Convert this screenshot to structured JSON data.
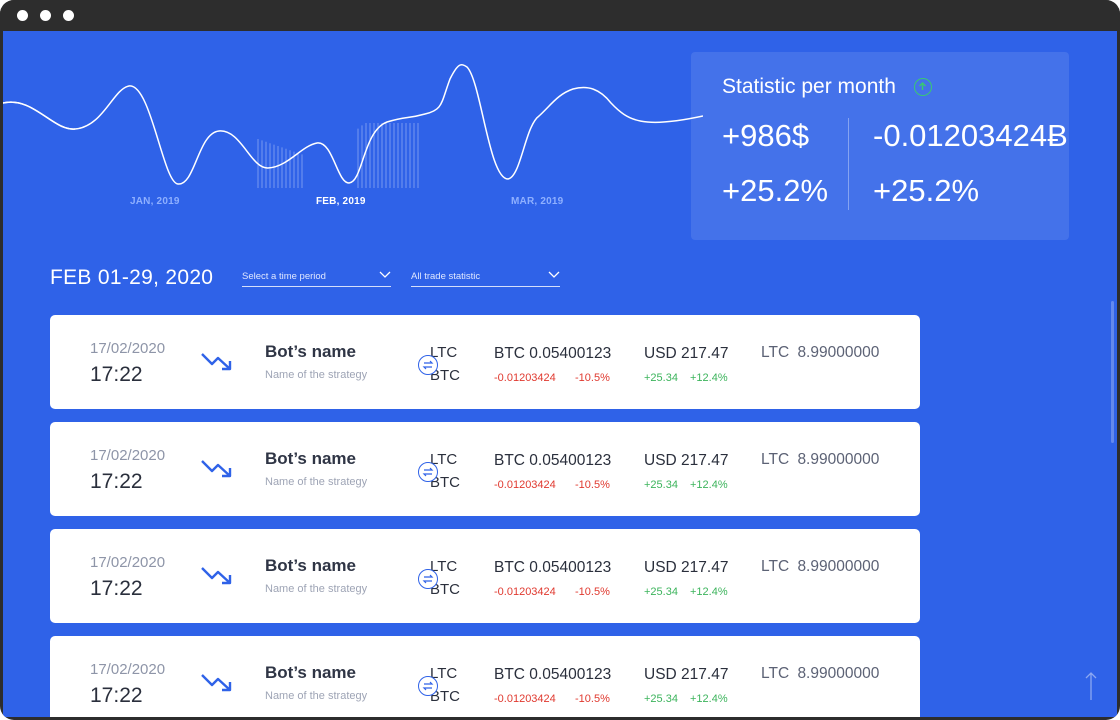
{
  "chart": {
    "months": [
      "JAN, 2019",
      "FEB, 2019",
      "MAR, 2019"
    ],
    "active_month": "FEB, 2019"
  },
  "stats": {
    "title": "Statistic per month",
    "usd_value": "+986$",
    "btc_value": "-0.01203424Ƀ",
    "usd_percent": "+25.2%",
    "btc_percent": "+25.2%"
  },
  "filters": {
    "period": "FEB 01-29, 2020",
    "time_period_placeholder": "Select a time period",
    "trade_statistic": "All trade statistic"
  },
  "trades": [
    {
      "date": "17/02/2020",
      "time": "17:22",
      "bot": "Bot’s name",
      "strategy": "Name of the strategy",
      "pair_from": "LTC",
      "pair_to": "BTC",
      "btc": "BTC 0.05400123",
      "btc_change": "-0.01203424",
      "btc_percent": "-10.5%",
      "usd": "USD 217.47",
      "usd_change": "+25.34",
      "usd_percent": "+12.4%",
      "ltc": "LTC 8.99000000"
    },
    {
      "date": "17/02/2020",
      "time": "17:22",
      "bot": "Bot’s name",
      "strategy": "Name of the strategy",
      "pair_from": "LTC",
      "pair_to": "BTC",
      "btc": "BTC 0.05400123",
      "btc_change": "-0.01203424",
      "btc_percent": "-10.5%",
      "usd": "USD 217.47",
      "usd_change": "+25.34",
      "usd_percent": "+12.4%",
      "ltc": "LTC 8.99000000"
    },
    {
      "date": "17/02/2020",
      "time": "17:22",
      "bot": "Bot’s name",
      "strategy": "Name of the strategy",
      "pair_from": "LTC",
      "pair_to": "BTC",
      "btc": "BTC 0.05400123",
      "btc_change": "-0.01203424",
      "btc_percent": "-10.5%",
      "usd": "USD 217.47",
      "usd_change": "+25.34",
      "usd_percent": "+12.4%",
      "ltc": "LTC 8.99000000"
    },
    {
      "date": "17/02/2020",
      "time": "17:22",
      "bot": "Bot’s name",
      "strategy": "Name of the strategy",
      "pair_from": "LTC",
      "pair_to": "BTC",
      "btc": "BTC 0.05400123",
      "btc_change": "-0.01203424",
      "btc_percent": "-10.5%",
      "usd": "USD 217.47",
      "usd_change": "+25.34",
      "usd_percent": "+12.4%",
      "ltc": "LTC 8.99000000"
    }
  ],
  "colors": {
    "background": "#2f62e8",
    "positive": "#3cb45c",
    "negative": "#e0392f",
    "accent_up": "#39c775"
  },
  "icons": {
    "window_controls": "dot",
    "trend": "trend-down-icon",
    "swap": "swap-icon",
    "stat_direction": "arrow-up-circle-icon",
    "dropdown": "chevron-down-icon",
    "scroll_top": "arrow-up-icon"
  }
}
